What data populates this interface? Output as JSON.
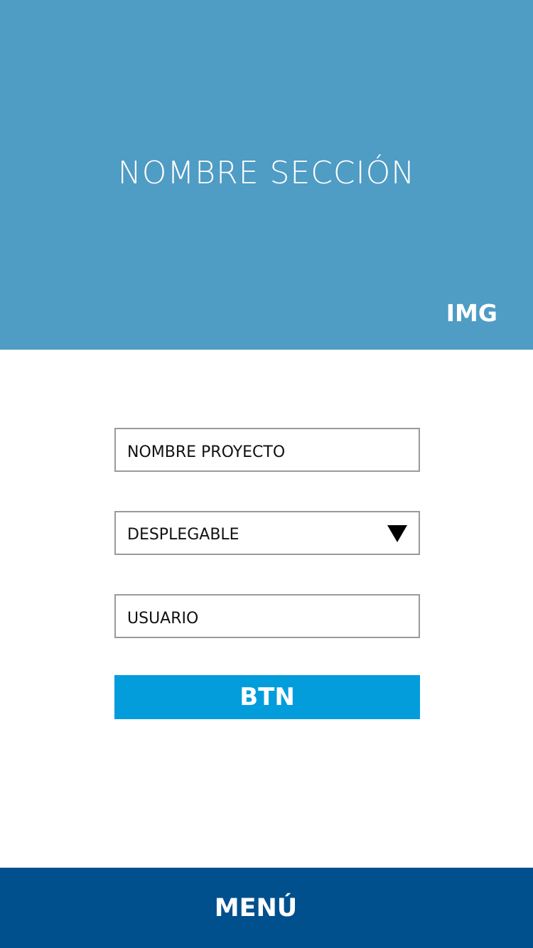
{
  "header": {
    "title": "NOMBRE SECCIÓN",
    "image_label": "IMG",
    "background_color": "#4f9cc4"
  },
  "form": {
    "project_name": {
      "placeholder": "NOMBRE PROYECTO"
    },
    "dropdown": {
      "selected": "DESPLEGABLE",
      "icon": "triangle-down-icon"
    },
    "user": {
      "placeholder": "USUARIO"
    },
    "button": {
      "label": "BTN",
      "color": "#039ddc"
    }
  },
  "footer": {
    "menu_label": "MENÚ",
    "background_color": "#00508d"
  }
}
